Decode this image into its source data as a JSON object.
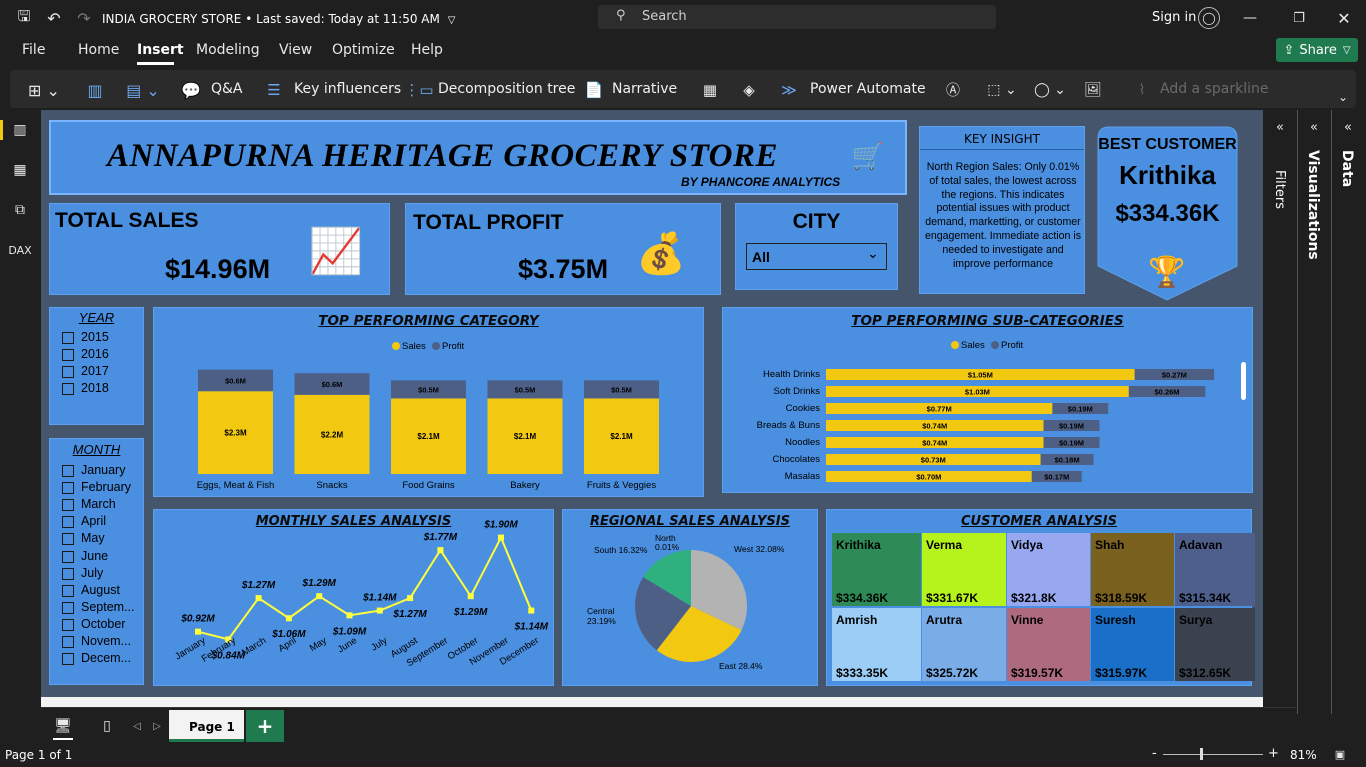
{
  "titlebar": {
    "doc_title": "INDIA GROCERY STORE",
    "saved": "Last saved: Today at 11:50 AM",
    "search_placeholder": "Search",
    "sign_in": "Sign in"
  },
  "menu": {
    "items": [
      "File",
      "Home",
      "Insert",
      "Modeling",
      "View",
      "Optimize",
      "Help"
    ],
    "active": "Insert",
    "share": "Share"
  },
  "ribbon": {
    "qa": "Q&A",
    "key_influencers": "Key influencers",
    "decomp": "Decomposition tree",
    "narrative": "Narrative",
    "power_automate": "Power Automate",
    "sparkline": "Add a sparkline"
  },
  "report": {
    "title": "ANNAPURNA HERITAGE GROCERY STORE",
    "subtitle": "BY PHANCORE ANALYTICS",
    "total_sales_label": "TOTAL SALES",
    "total_sales": "$14.96M",
    "total_profit_label": "TOTAL PROFIT",
    "total_profit": "$3.75M",
    "city_label": "CITY",
    "city_value": "All",
    "key_insight_title": "KEY INSIGHT",
    "key_insight_text": "North Region Sales: Only 0.01% of total sales, the lowest across the regions. This indicates potential issues with product demand, marketting, or customer engagement. Immediate action is needed to investigate and improve performance",
    "best_customer_label": "BEST CUSTOMER",
    "best_customer_name": "Krithika",
    "best_customer_value": "$334.36K",
    "year_title": "YEAR",
    "years": [
      "2015",
      "2016",
      "2017",
      "2018"
    ],
    "month_title": "MONTH",
    "months": [
      "January",
      "February",
      "March",
      "April",
      "May",
      "June",
      "July",
      "August",
      "Septem...",
      "October",
      "Novem...",
      "Decem..."
    ],
    "customer_title": "CUSTOMER ANALYSIS",
    "customers": [
      {
        "name": "Krithika",
        "value": "$334.36K",
        "color": "#2e8b57"
      },
      {
        "name": "Verma",
        "value": "$331.67K",
        "color": "#b6f21c"
      },
      {
        "name": "Vidya",
        "value": "$321.8K",
        "color": "#97a8f0"
      },
      {
        "name": "Shah",
        "value": "$318.59K",
        "color": "#7b6120"
      },
      {
        "name": "Adavan",
        "value": "$315.34K",
        "color": "#4f5f8c"
      },
      {
        "name": "Amrish",
        "value": "$333.35K",
        "color": "#9ccdf7"
      },
      {
        "name": "Arutra",
        "value": "$325.72K",
        "color": "#7aace8"
      },
      {
        "name": "Vinne",
        "value": "$319.57K",
        "color": "#ae6b80"
      },
      {
        "name": "Suresh",
        "value": "$315.97K",
        "color": "#1a6fc9"
      },
      {
        "name": "Surya",
        "value": "$312.65K",
        "color": "#3a4250"
      }
    ]
  },
  "colors": {
    "sales": "#f2c811",
    "profit": "#4e5f86",
    "panel": "#4a8fe0",
    "canvas": "#44556c"
  },
  "chart_data": [
    {
      "type": "bar",
      "title": "TOP PERFORMING CATEGORY",
      "legend": [
        "Sales",
        "Profit"
      ],
      "categories": [
        "Eggs, Meat & Fish",
        "Snacks",
        "Food Grains",
        "Bakery",
        "Fruits & Veggies"
      ],
      "series": [
        {
          "name": "Sales",
          "values": [
            2.3,
            2.2,
            2.1,
            2.1,
            2.1
          ],
          "labels": [
            "$2.3M",
            "$2.2M",
            "$2.1M",
            "$2.1M",
            "$2.1M"
          ]
        },
        {
          "name": "Profit",
          "values": [
            0.6,
            0.6,
            0.5,
            0.5,
            0.5
          ],
          "labels": [
            "$0.6M",
            "$0.6M",
            "$0.5M",
            "$0.5M",
            "$0.5M"
          ]
        }
      ],
      "stacked": true
    },
    {
      "type": "bar",
      "orientation": "horizontal",
      "title": "TOP PERFORMING SUB-CATEGORIES",
      "legend": [
        "Sales",
        "Profit"
      ],
      "categories": [
        "Health Drinks",
        "Soft Drinks",
        "Cookies",
        "Breads & Buns",
        "Noodles",
        "Chocolates",
        "Masalas"
      ],
      "series": [
        {
          "name": "Sales",
          "values": [
            1.05,
            1.03,
            0.77,
            0.74,
            0.74,
            0.73,
            0.7
          ],
          "labels": [
            "$1.05M",
            "$1.03M",
            "$0.77M",
            "$0.74M",
            "$0.74M",
            "$0.73M",
            "$0.70M"
          ]
        },
        {
          "name": "Profit",
          "values": [
            0.27,
            0.26,
            0.19,
            0.19,
            0.19,
            0.18,
            0.17
          ],
          "labels": [
            "$0.27M",
            "$0.26M",
            "$0.19M",
            "$0.19M",
            "$0.19M",
            "$0.18M",
            "$0.17M"
          ]
        }
      ],
      "stacked": true
    },
    {
      "type": "line",
      "title": "MONTHLY SALES ANALYSIS",
      "categories": [
        "January",
        "February",
        "March",
        "April",
        "May",
        "June",
        "July",
        "August",
        "September",
        "October",
        "November",
        "December"
      ],
      "values": [
        0.92,
        0.84,
        1.27,
        1.06,
        1.29,
        1.09,
        1.14,
        1.27,
        1.77,
        1.29,
        1.9,
        1.14
      ],
      "labels": [
        "$0.92M",
        "$0.84M",
        "$1.27M",
        "$1.06M",
        "$1.29M",
        "$1.09M",
        "$1.14M",
        "$1.27M",
        "$1.77M",
        "$1.29M",
        "$1.90M",
        "$1.14M"
      ]
    },
    {
      "type": "pie",
      "title": "REGIONAL SALES ANALYSIS",
      "slices": [
        {
          "name": "West",
          "value": 32.08,
          "label": "West 32.08%",
          "color": "#b3b3b3"
        },
        {
          "name": "East",
          "value": 28.4,
          "label": "East 28.4%",
          "color": "#f2c811"
        },
        {
          "name": "Central",
          "value": 23.19,
          "label": "Central 23.19%",
          "color": "#4e5f86"
        },
        {
          "name": "South",
          "value": 16.32,
          "label": "South 16.32%",
          "color": "#2fb07f"
        },
        {
          "name": "North",
          "value": 0.01,
          "label": "North 0.01%",
          "color": "#1f5ec2"
        }
      ]
    }
  ],
  "rightpanes": {
    "filters": "Filters",
    "visualizations": "Visualizations",
    "data": "Data"
  },
  "pages": {
    "tab": "Page 1"
  },
  "status": {
    "page": "Page 1 of 1",
    "zoom": "81%"
  }
}
